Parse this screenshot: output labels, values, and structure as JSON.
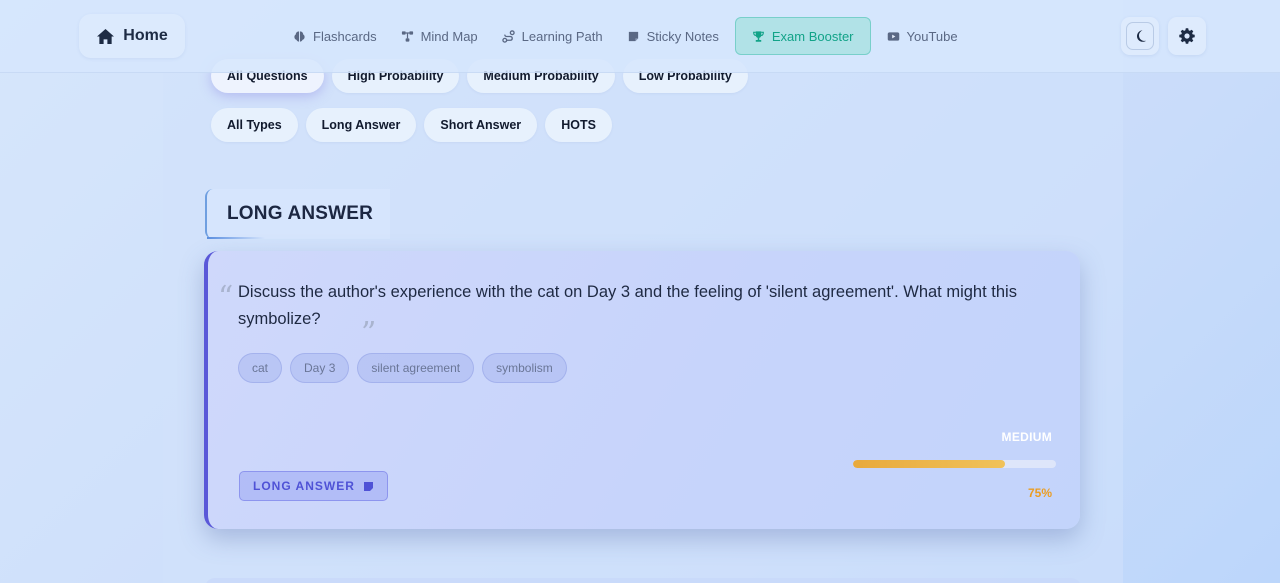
{
  "nav": {
    "home_label": "Home",
    "items": [
      {
        "label": "Flashcards",
        "icon": "brain-icon"
      },
      {
        "label": "Mind Map",
        "icon": "mindmap-icon"
      },
      {
        "label": "Learning Path",
        "icon": "path-icon"
      },
      {
        "label": "Sticky Notes",
        "icon": "note-icon"
      },
      {
        "label": "Exam Booster",
        "icon": "trophy-icon",
        "active": true
      },
      {
        "label": "YouTube",
        "icon": "youtube-icon"
      }
    ],
    "theme_toggle_icon": "moon-icon",
    "settings_icon": "gear-icon"
  },
  "filters": {
    "probability": [
      "All Questions",
      "High Probability",
      "Medium Probability",
      "Low Probability"
    ],
    "probability_selected": "All Questions",
    "types": [
      "All Types",
      "Long Answer",
      "Short Answer",
      "HOTS"
    ]
  },
  "section": {
    "title": "LONG ANSWER"
  },
  "question": {
    "text": "Discuss the author's experience with the cat on Day 3 and the feeling of 'silent agreement'. What might this symbolize?",
    "tags": [
      "cat",
      "Day 3",
      "silent agreement",
      "symbolism"
    ],
    "type_badge": "LONG ANSWER",
    "probability_label": "MEDIUM",
    "probability_value": 0.75,
    "probability_percent": "75%"
  },
  "colors": {
    "accent": "#5a58d8",
    "active_nav": "#12a388",
    "probability_bar": "#e8a93c"
  }
}
